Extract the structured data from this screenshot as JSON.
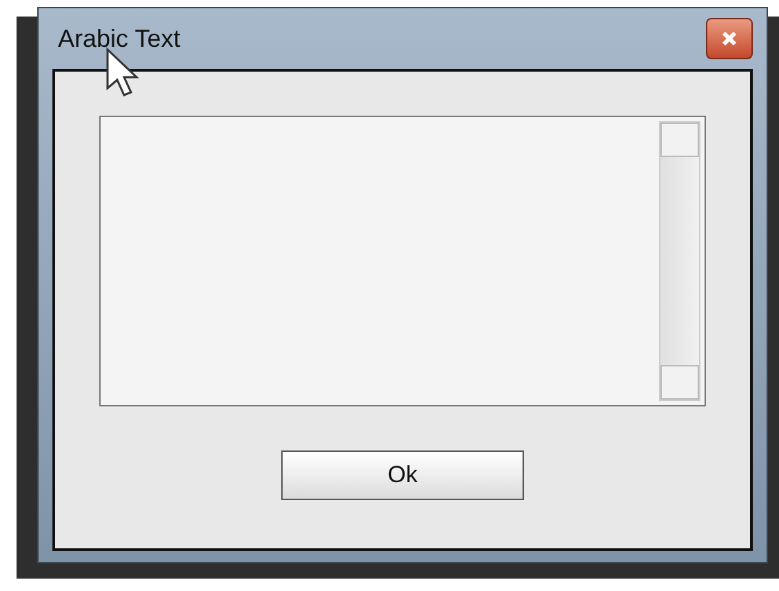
{
  "window": {
    "title": "Arabic Text"
  },
  "buttons": [
    {
      "label": "Ok"
    }
  ]
}
